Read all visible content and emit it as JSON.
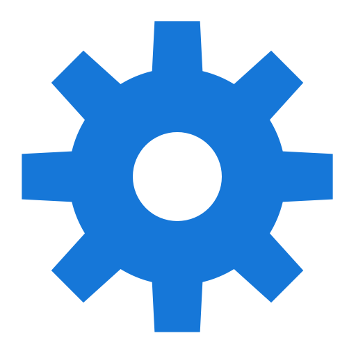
{
  "icon": {
    "name": "gear-icon",
    "semantic": "settings",
    "colors": {
      "fill": "#1677d8",
      "hole": "#ffffff",
      "background": "#ffffff"
    }
  }
}
